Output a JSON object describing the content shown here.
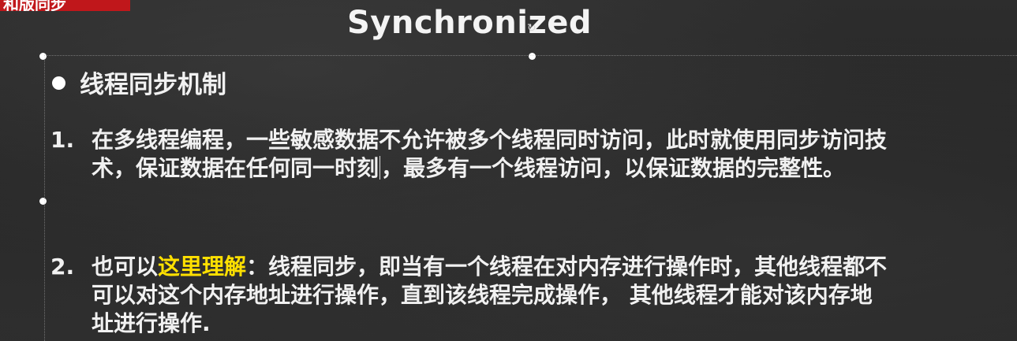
{
  "slide": {
    "corner_tag": "和版同步",
    "title": "Synchronized",
    "heading": "线程同步机制",
    "items": [
      {
        "number": "1.",
        "lines": [
          "在多线程编程，一些敏感数据不允许被多个线程同时访问，此时就使用同步访问技",
          "术，保证数据在任何同一时刻",
          "，最多有一个线程访问，以保证数据的完整性。"
        ]
      },
      {
        "number": "2.",
        "prefix": "也可以",
        "highlight": "这里理解",
        "rest": "：线程同步，即当有一个线程在对内存进行操作时，其他线程都不",
        "lines": [
          "可以对这个内存地址进行操作，直到该线程完成操作， 其他线程才能对该内存地",
          "址进行操作."
        ]
      }
    ],
    "colors": {
      "background": "#2a2a2a",
      "text": "#f1f1f1",
      "highlight": "#ffe000",
      "corner_tag": "#c0171b"
    }
  }
}
